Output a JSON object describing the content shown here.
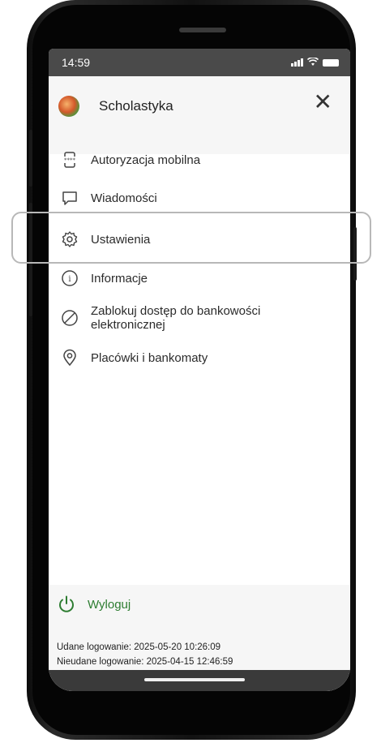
{
  "status_bar": {
    "time": "14:59"
  },
  "profile": {
    "name": "Scholastyka",
    "close_symbol": "✕"
  },
  "menu": {
    "items": [
      {
        "label": "Autoryzacja mobilna",
        "icon": "mobile-authorization-icon"
      },
      {
        "label": "Wiadomości",
        "icon": "message-icon"
      },
      {
        "label": "Ustawienia",
        "icon": "gear-icon"
      },
      {
        "label": "Informacje",
        "icon": "info-icon"
      },
      {
        "label_line1": "Zablokuj dostęp do bankowości",
        "label_line2": "elektronicznej",
        "icon": "block-icon"
      },
      {
        "label": "Placówki i bankomaty",
        "icon": "location-pin-icon"
      }
    ]
  },
  "logout": {
    "label": "Wyloguj",
    "icon": "power-icon",
    "color": "#2e7d32"
  },
  "login_info": {
    "success": "Udane logowanie: 2025-05-20 10:26:09",
    "failed": "Nieudane logowanie: 2025-04-15 12:46:59"
  }
}
